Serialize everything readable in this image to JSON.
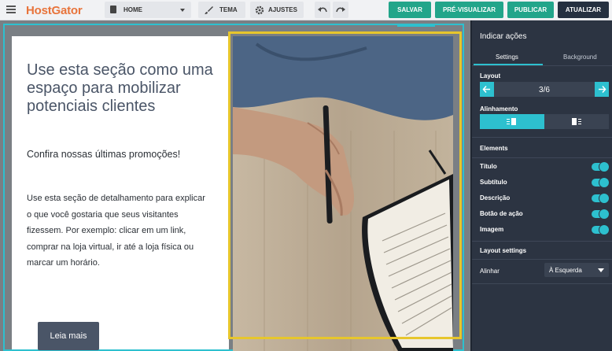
{
  "app": {
    "brand": "HostGator"
  },
  "toolbar": {
    "page_select": "HOME",
    "tema": "TEMA",
    "ajustes": "AJUSTES",
    "salvar": "SALVAR",
    "pre_visualizar": "PRÉ-VISUALIZAR",
    "publicar": "PUBLICAR",
    "atualizar": "ATUALIZAR"
  },
  "section": {
    "title": "Use esta seção como uma espaço para mobilizar potenciais clientes",
    "subtitle": "Confira nossas últimas promoções!",
    "description": "Use esta seção de detalhamento para explicar o que você gostaria que seus visitantes fizessem. Por exemplo: clicar em um link, comprar na loja virtual, ir até a loja física ou marcar um horário.",
    "cta": "Leia mais"
  },
  "panel": {
    "title": "Indicar ações",
    "tabs": [
      "Settings",
      "Background"
    ],
    "layout_label": "Layout",
    "layout_value": "3/6",
    "alignment_label": "Alinhamento",
    "elements_label": "Elements",
    "elements": [
      {
        "label": "Título",
        "on": true
      },
      {
        "label": "Subtítulo",
        "on": true
      },
      {
        "label": "Descrição",
        "on": true
      },
      {
        "label": "Botão de ação",
        "on": true
      },
      {
        "label": "Imagem",
        "on": true
      }
    ],
    "layout_settings_label": "Layout settings",
    "align_label": "Alinhar",
    "align_value": "À Esquerda"
  },
  "colors": {
    "accent": "#2dc0cf",
    "brand": "#e8743b",
    "primary_button": "#22a58a",
    "dark_button": "#253040",
    "selection_frame": "#e7c62c"
  }
}
